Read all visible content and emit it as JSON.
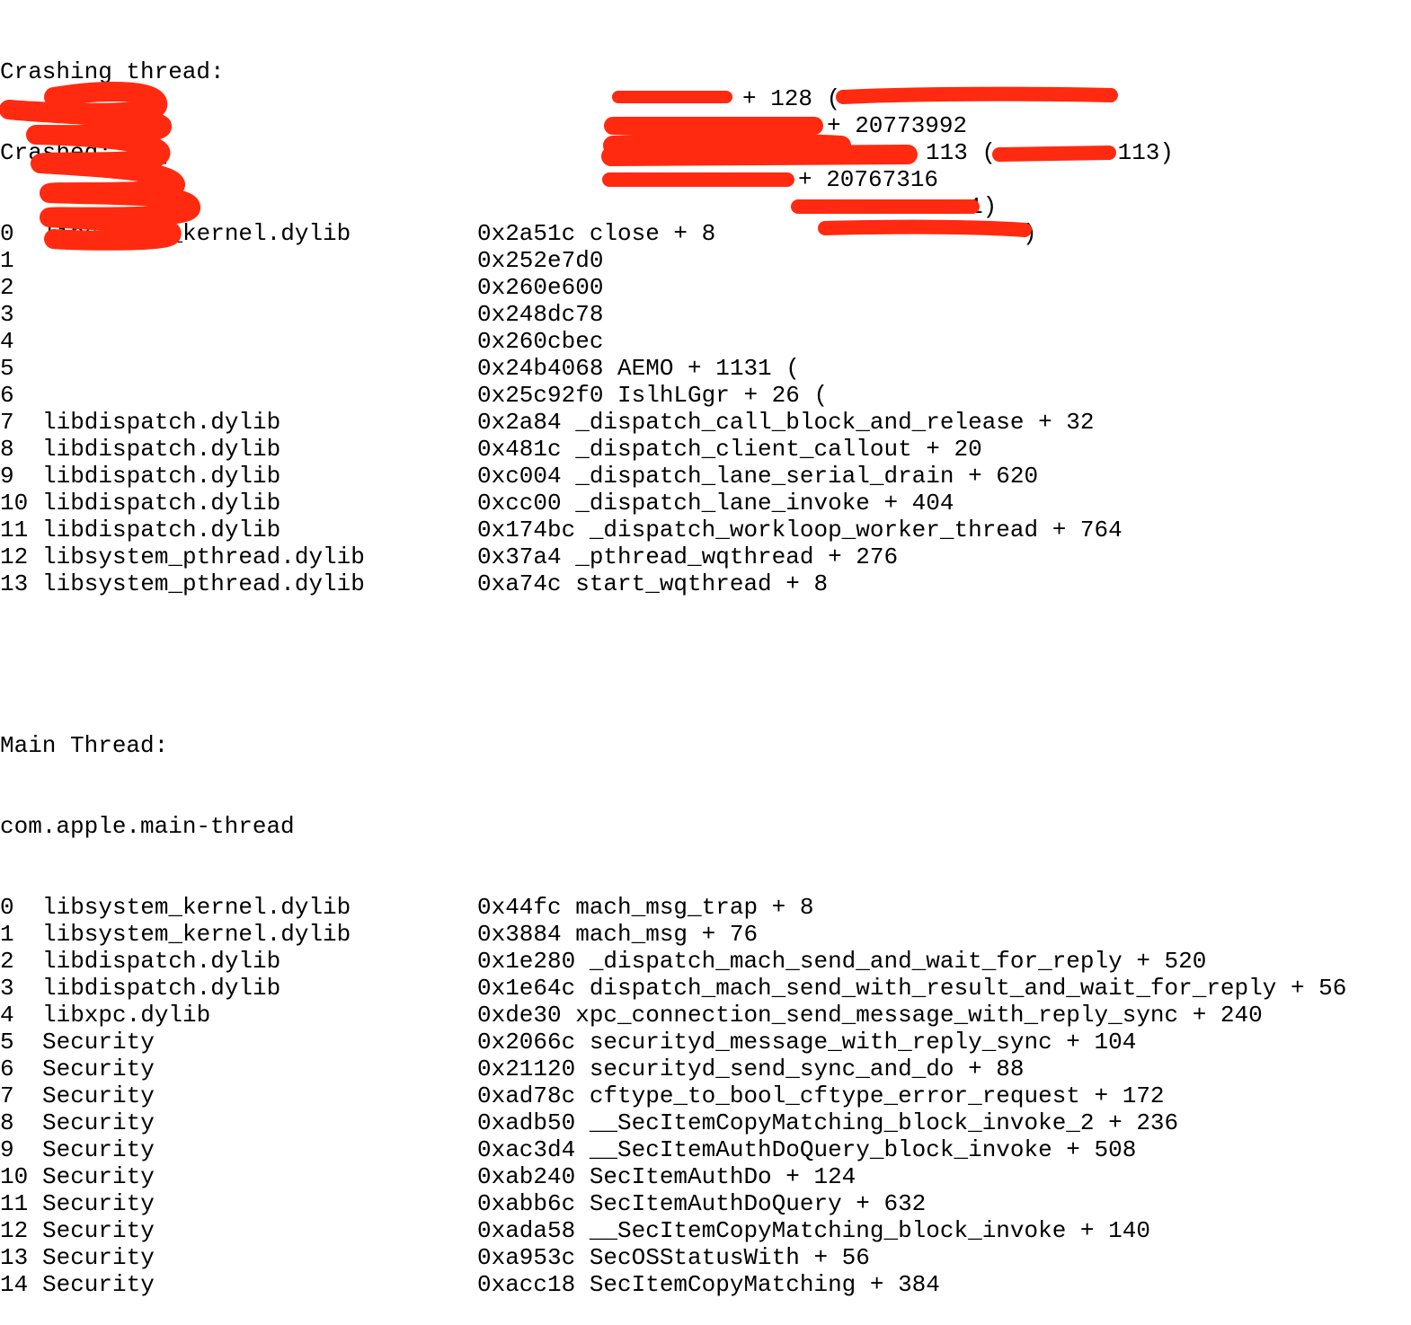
{
  "crashing": {
    "header": "Crashing thread:",
    "subheader": "Crashed: ldq",
    "frames": [
      {
        "num": "0",
        "lib": "libsystem_kernel.dylib",
        "sym": "0x2a51c close + 8"
      },
      {
        "num": "1",
        "lib": "",
        "sym": "0x252e7d0 ",
        "redacted": true
      },
      {
        "num": "2",
        "lib": "",
        "sym": "0x260e600 ",
        "redacted": true
      },
      {
        "num": "3",
        "lib": "",
        "sym": "0x248dc78",
        "redacted": true
      },
      {
        "num": "4",
        "lib": "",
        "sym": "0x260cbec ",
        "redacted": true
      },
      {
        "num": "5",
        "lib": "",
        "sym": "0x24b4068 AEMO + 1131 (",
        "redacted": true
      },
      {
        "num": "6",
        "lib": "",
        "sym": "0x25c92f0 IslhLGgr + 26 (",
        "redacted": true
      },
      {
        "num": "7",
        "lib": "libdispatch.dylib",
        "sym": "0x2a84 _dispatch_call_block_and_release + 32"
      },
      {
        "num": "8",
        "lib": "libdispatch.dylib",
        "sym": "0x481c _dispatch_client_callout + 20"
      },
      {
        "num": "9",
        "lib": "libdispatch.dylib",
        "sym": "0xc004 _dispatch_lane_serial_drain + 620"
      },
      {
        "num": "10",
        "lib": "libdispatch.dylib",
        "sym": "0xcc00 _dispatch_lane_invoke + 404"
      },
      {
        "num": "11",
        "lib": "libdispatch.dylib",
        "sym": "0x174bc _dispatch_workloop_worker_thread + 764"
      },
      {
        "num": "12",
        "lib": "libsystem_pthread.dylib",
        "sym": "0x37a4 _pthread_wqthread + 276"
      },
      {
        "num": "13",
        "lib": "libsystem_pthread.dylib",
        "sym": "0xa74c start_wqthread + 8"
      }
    ],
    "visible_fragments": {
      "f1_offset": "+ 128 (",
      "f2_offset": "+ 20773992",
      "f3_offset": "113 (",
      "f3_tail": ".113)",
      "f4_offset": "+ 20767316",
      "f5_tail": "1)",
      "f6_tail": ")"
    }
  },
  "main": {
    "header": "Main Thread:",
    "subheader": "com.apple.main-thread",
    "frames": [
      {
        "num": "0",
        "lib": "libsystem_kernel.dylib",
        "sym": "0x44fc mach_msg_trap + 8"
      },
      {
        "num": "1",
        "lib": "libsystem_kernel.dylib",
        "sym": "0x3884 mach_msg + 76"
      },
      {
        "num": "2",
        "lib": "libdispatch.dylib",
        "sym": "0x1e280 _dispatch_mach_send_and_wait_for_reply + 520"
      },
      {
        "num": "3",
        "lib": "libdispatch.dylib",
        "sym": "0x1e64c dispatch_mach_send_with_result_and_wait_for_reply + 56"
      },
      {
        "num": "4",
        "lib": "libxpc.dylib",
        "sym": "0xde30 xpc_connection_send_message_with_reply_sync + 240"
      },
      {
        "num": "5",
        "lib": "Security",
        "sym": "0x2066c securityd_message_with_reply_sync + 104"
      },
      {
        "num": "6",
        "lib": "Security",
        "sym": "0x21120 securityd_send_sync_and_do + 88"
      },
      {
        "num": "7",
        "lib": "Security",
        "sym": "0xad78c cftype_to_bool_cftype_error_request + 172"
      },
      {
        "num": "8",
        "lib": "Security",
        "sym": "0xadb50 __SecItemCopyMatching_block_invoke_2 + 236"
      },
      {
        "num": "9",
        "lib": "Security",
        "sym": "0xac3d4 __SecItemAuthDoQuery_block_invoke + 508"
      },
      {
        "num": "10",
        "lib": "Security",
        "sym": "0xab240 SecItemAuthDo + 124"
      },
      {
        "num": "11",
        "lib": "Security",
        "sym": "0xabb6c SecItemAuthDoQuery + 632"
      },
      {
        "num": "12",
        "lib": "Security",
        "sym": "0xada58 __SecItemCopyMatching_block_invoke + 140"
      },
      {
        "num": "13",
        "lib": "Security",
        "sym": "0xa953c SecOSStatusWith + 56"
      },
      {
        "num": "14",
        "lib": "Security",
        "sym": "0xacc18 SecItemCopyMatching + 384"
      }
    ]
  },
  "redaction_color": "#ff2a10"
}
